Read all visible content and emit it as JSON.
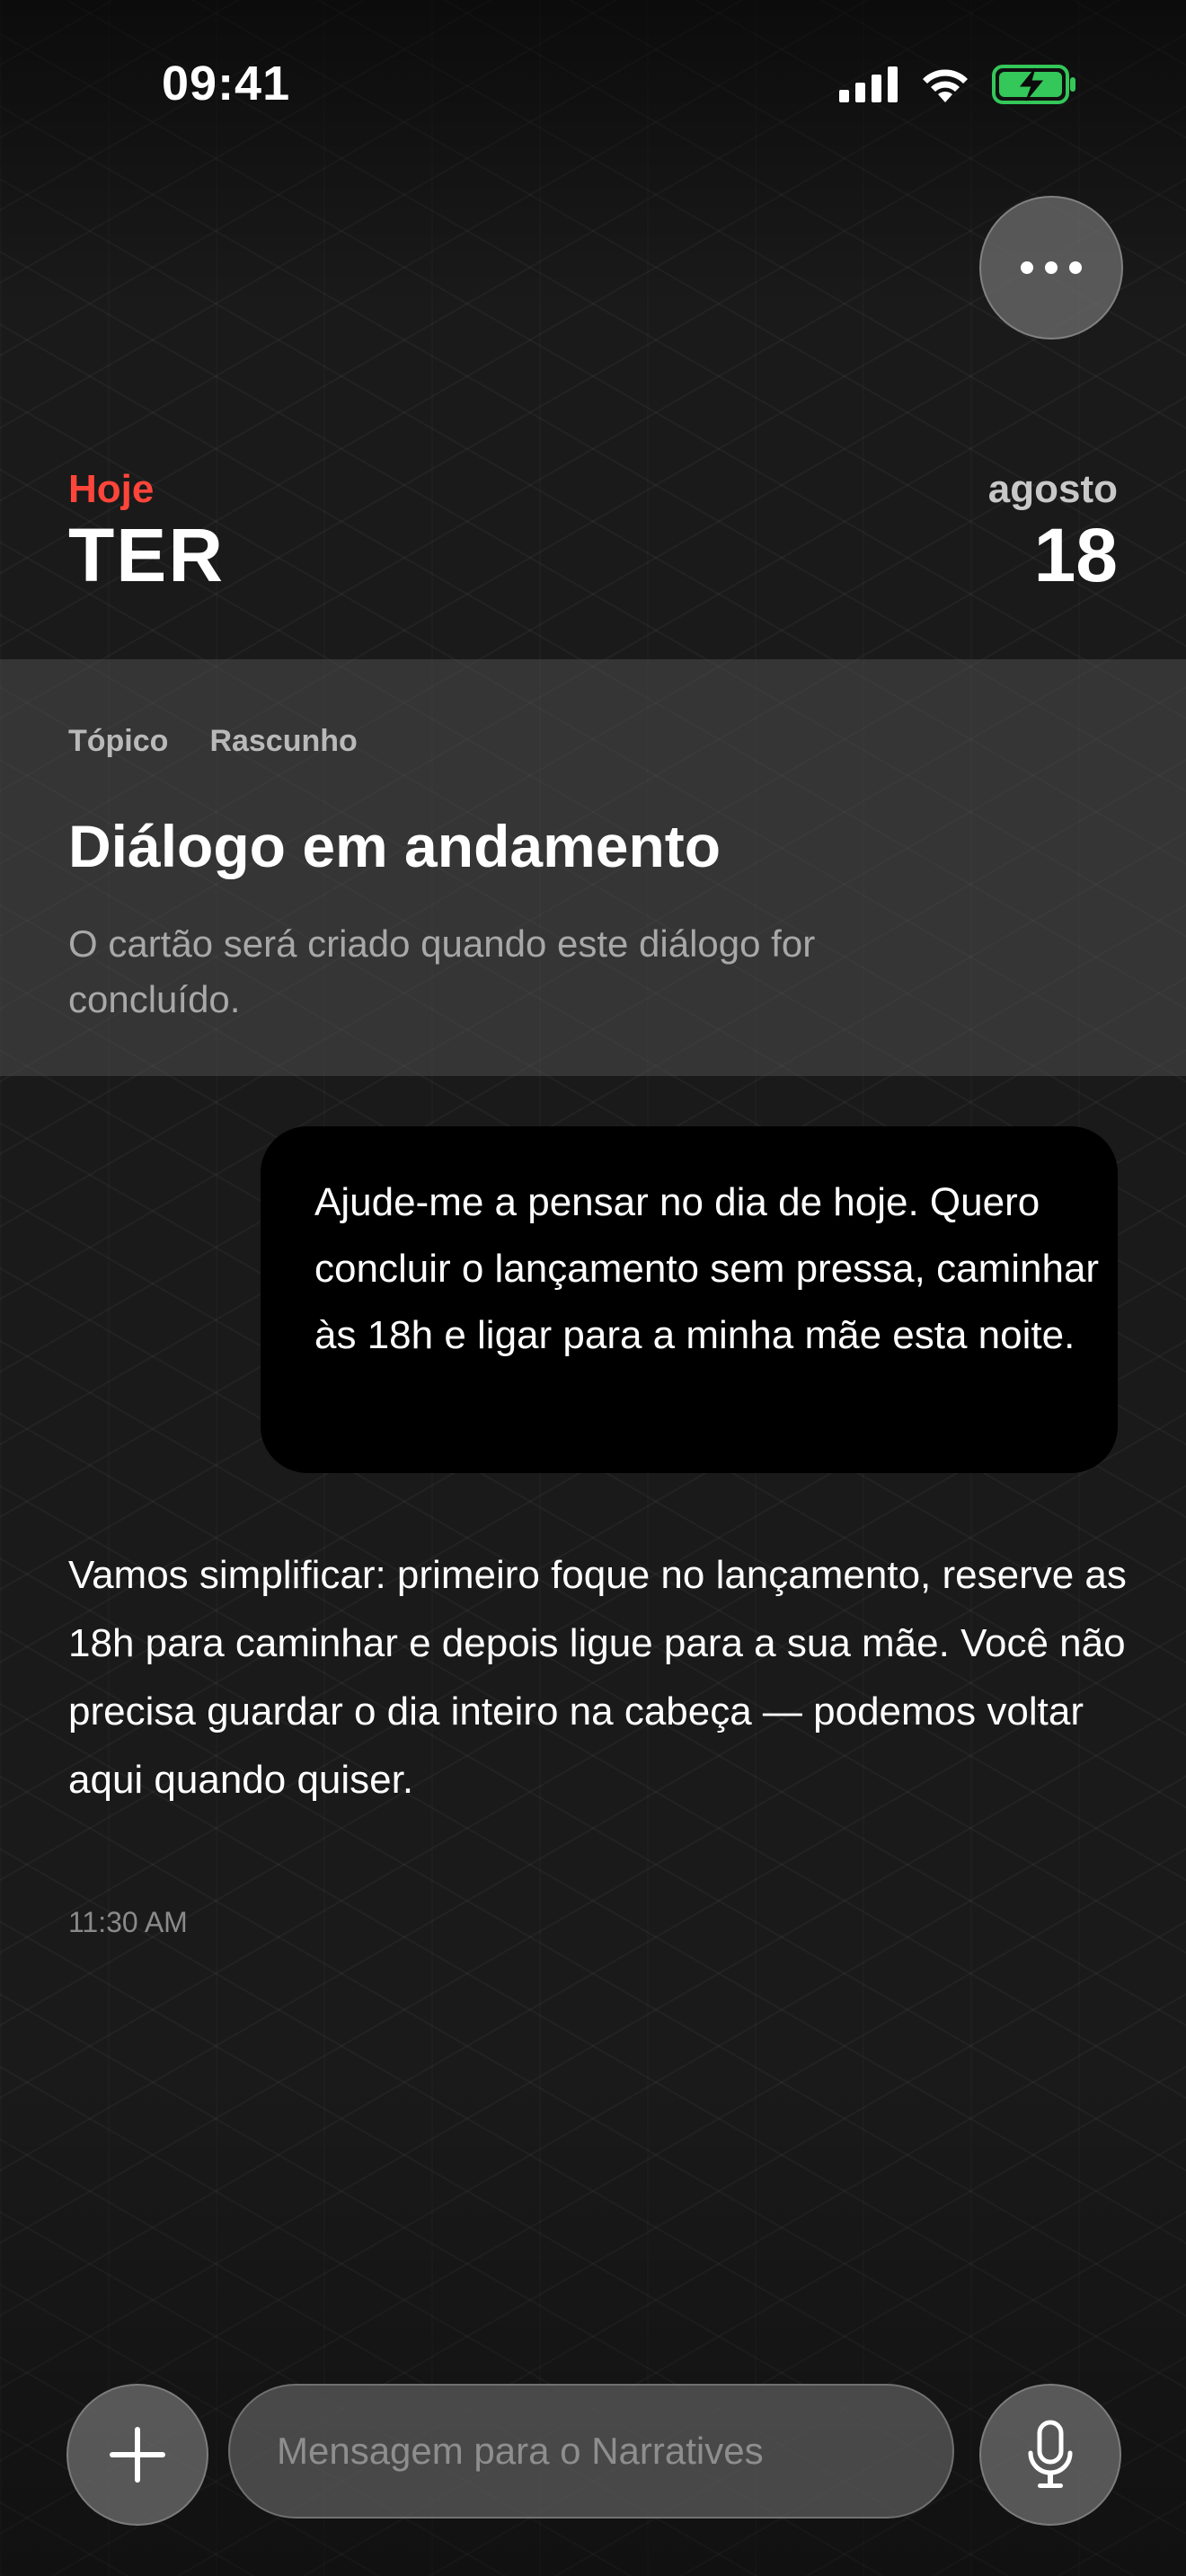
{
  "status_bar": {
    "time": "09:41",
    "icons": [
      "signal-icon",
      "wifi-icon",
      "battery-charging-icon"
    ],
    "battery_color": "#34c759"
  },
  "header": {
    "more_icon": "ellipsis-icon",
    "today_label": "Hoje",
    "weekday": "TER",
    "month": "agosto",
    "day": "18",
    "accent_color": "#ff453a"
  },
  "topic": {
    "tags": [
      "Tópico",
      "Rascunho"
    ],
    "title": "Diálogo em andamento",
    "description": "O cartão será criado quando este diálogo for concluído."
  },
  "messages": [
    {
      "role": "user",
      "text": "Ajude-me a pensar no dia de hoje. Quero concluir o lançamento sem pressa, caminhar às 18h e ligar para a minha mãe esta noite."
    },
    {
      "role": "assistant",
      "text": "Vamos simplificar: primeiro foque no lançamento, reserve as 18h para caminhar e depois ligue para a sua mãe. Você não precisa guardar o dia inteiro na cabeça — podemos voltar aqui quando quiser.",
      "time": "11:30 AM"
    }
  ],
  "composer": {
    "add_icon": "plus-icon",
    "placeholder": "Mensagem para o Narratives",
    "mic_icon": "microphone-icon"
  }
}
